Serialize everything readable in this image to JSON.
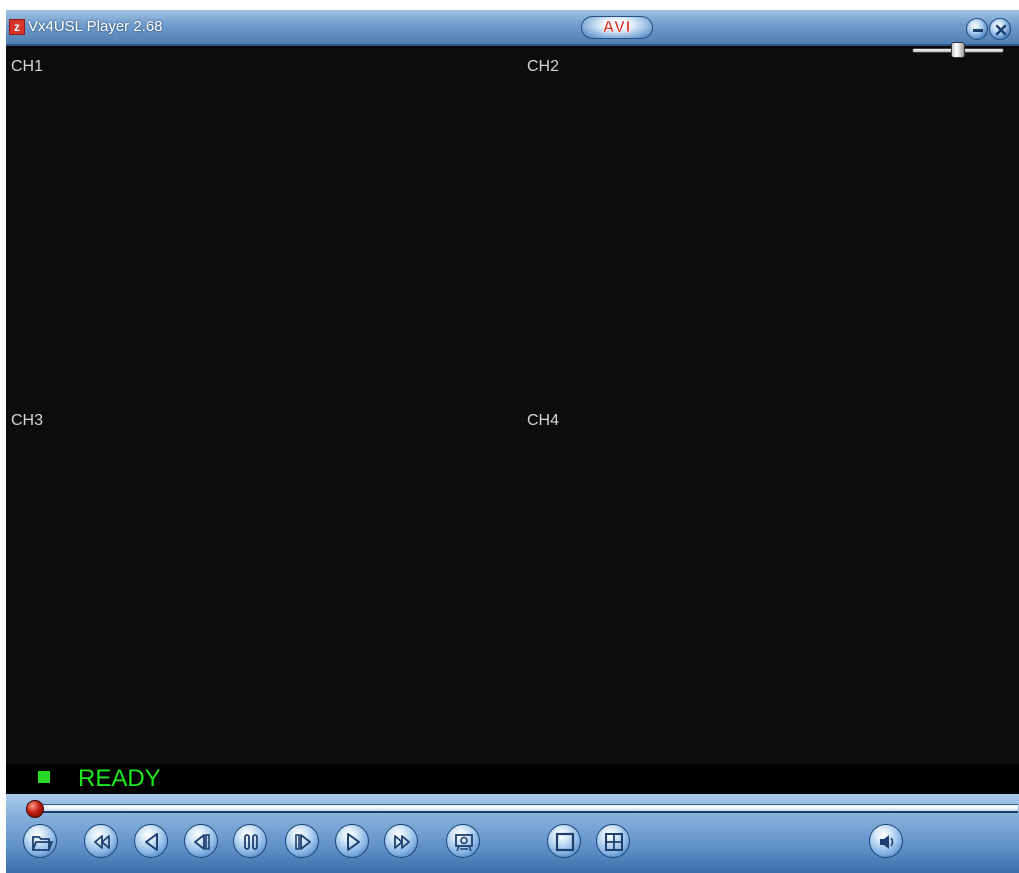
{
  "window": {
    "title": "Vx4USL Player 2.68",
    "format_badge": "AVI",
    "app_icon": "app-logo-icon",
    "minimize_icon": "minimize-icon",
    "close_icon": "close-icon"
  },
  "channels": [
    {
      "label": "CH1"
    },
    {
      "label": "CH2"
    },
    {
      "label": "CH3"
    },
    {
      "label": "CH4"
    }
  ],
  "status": {
    "text": "READY",
    "color": "#1ee81e"
  },
  "playback": {
    "progress": 0
  },
  "controls": [
    {
      "name": "open-file",
      "icon": "open-folder-icon"
    },
    {
      "name": "fast-rewind",
      "icon": "fast-rewind-icon"
    },
    {
      "name": "play-reverse",
      "icon": "play-reverse-icon"
    },
    {
      "name": "step-back",
      "icon": "step-back-icon"
    },
    {
      "name": "pause",
      "icon": "pause-icon"
    },
    {
      "name": "step-forward",
      "icon": "step-forward-icon"
    },
    {
      "name": "play",
      "icon": "play-icon"
    },
    {
      "name": "fast-forward",
      "icon": "fast-forward-icon"
    },
    {
      "name": "snapshot",
      "icon": "snapshot-icon"
    },
    {
      "name": "single-view",
      "icon": "single-view-icon"
    },
    {
      "name": "quad-view",
      "icon": "quad-view-icon"
    },
    {
      "name": "volume",
      "icon": "speaker-icon"
    }
  ],
  "volume": {
    "level": 0.45
  },
  "colors": {
    "accent": "#4f7fb5",
    "badge_text": "#d8221a",
    "seek_knob": "#c51d10"
  }
}
